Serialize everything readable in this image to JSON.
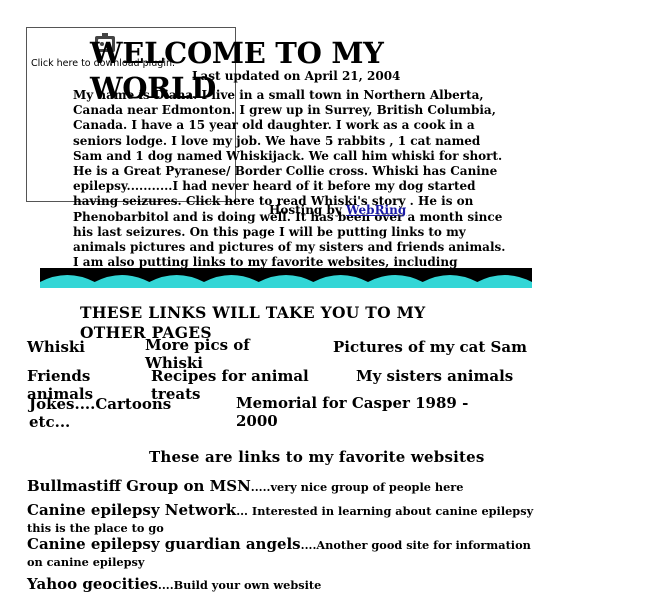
{
  "download": {
    "label": "Click here to download plugin.",
    "icon": "plugin-puzzle-icon"
  },
  "header": {
    "title": "WELCOME TO MY WORLD",
    "updated": "Last updated on April 21, 2004"
  },
  "intro": {
    "text": "My name is Diana. I live in a small town in Northern Alberta, Canada near Edmonton. I grew up in Surrey, British Columbia, Canada. I have a 15 year old daughter. I work as a cook in a seniors lodge. I love my job.  We have 5 rabbits , 1 cat named Sam and 1 dog named Whiskijack. We call him whiski for short. He is a Great Pyranese/ Border Collie cross. Whiski has Canine epilepsy...........I had never heard of it before my dog started having seizures. Click here to read  Whiski's story .  He is on Phenobarbitol  and  is doing well. It has been over a month since his last seizures. On this page I will be putting links to my animals pictures and pictures of my sisters and friends animals. I am also putting links to my favorite websites, including websites to do with canine epilepsy if anyone is interested in reading about it. Please sign my guestbook. It is located at the bottom of this page.  Check back often to this page as I",
    "overlay_prefix": "Hosting by",
    "overlay_link": "WebRing"
  },
  "links_section": {
    "heading": "THESE LINKS WILL TAKE YOU TO MY OTHER PAGES",
    "links": [
      "Whiski",
      "More pics of Whiski",
      "Pictures of my cat Sam",
      "Friends animals",
      "Recipes for animal treats",
      "My sisters animals",
      "Jokes....Cartoons etc...",
      "Memorial for  Casper  1989 - 2000"
    ]
  },
  "favorites": {
    "heading": "These are links to my favorite websites",
    "items": [
      {
        "title": "Bullmastiff Group on MSN",
        "desc": ".....very nice group of people here"
      },
      {
        "title": "Canine epilepsy Network",
        "desc": "... Interested in learning about canine epilepsy this is the place to go"
      },
      {
        "title": "Canine epilepsy guardian angels",
        "desc": "....Another good site for information on canine epilepsy"
      },
      {
        "title": "Yahoo geocities",
        "desc": "....Build your own website"
      }
    ]
  },
  "colors": {
    "wave_dark": "#000000",
    "wave_light": "#33d6d6",
    "link": "#1a1aa6"
  }
}
